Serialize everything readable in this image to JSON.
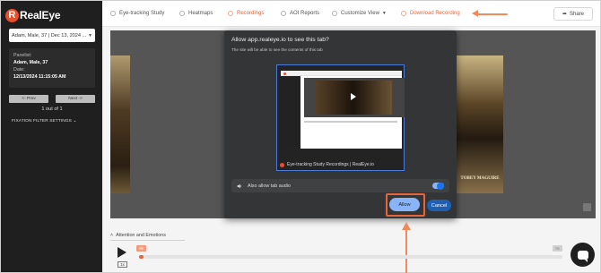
{
  "app": {
    "logo_text": "RealEye",
    "accent_color": "#e8643a"
  },
  "sidebar": {
    "selected_recording": "Adam, Male, 37 | Dec 13, 2024 ...",
    "panelist_label": "Panelist:",
    "panelist_value": "Adam, Male, 37",
    "date_label": "Date:",
    "date_value": "12/13/2024 11:15:05 AM",
    "prev_label": "<- Prev",
    "next_label": "Next ->",
    "count_label": "1 out of 1",
    "fixation_filter_label": "FIXATION FILTER SETTINGS"
  },
  "nav": {
    "items": [
      {
        "label": "Eye-tracking Study",
        "icon": "eye-icon"
      },
      {
        "label": "Heatmaps",
        "icon": "heatmap-icon"
      },
      {
        "label": "Recordings",
        "icon": "recordings-icon"
      },
      {
        "label": "AOI Reports",
        "icon": "aoi-icon"
      },
      {
        "label": "Customize View",
        "icon": "customize-icon"
      },
      {
        "label": "Download Recording",
        "icon": "download-icon"
      }
    ],
    "share_label": "Share"
  },
  "video": {
    "poster_name": "TOBEY MAGUIRE"
  },
  "dialog": {
    "title": "Allow app.realeye.io to see this tab?",
    "subtitle": "The site will be able to see the contents of this tab",
    "tab_title": "Eye-tracking Study Recordings | RealEye.io",
    "audio_label": "Also allow tab audio",
    "audio_enabled": true,
    "allow_label": "Allow",
    "cancel_label": "Cancel"
  },
  "player": {
    "section_label": "Attention and Emotions",
    "speed_label": "1x",
    "time_start": "0s",
    "time_end": "0s",
    "progress_fraction": 0.01
  }
}
